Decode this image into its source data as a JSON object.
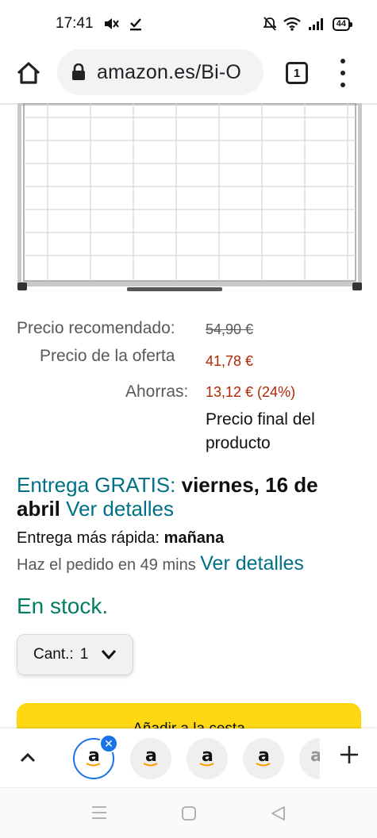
{
  "status_bar": {
    "time": "17:41",
    "battery": "44"
  },
  "browser": {
    "url": "amazon.es/Bi-O",
    "tab_count": "1"
  },
  "product": {
    "price_recommended_label": "Precio recomendado:",
    "price_recommended_value": "54,90 €",
    "deal_price_label": "Precio de la oferta",
    "deal_price_value": "41,78 €",
    "savings_label": "Ahorras:",
    "savings_value": "13,12 € (24%)",
    "final_price_note": "Precio final del producto"
  },
  "delivery": {
    "free_label": "Entrega GRATIS:",
    "date": "viernes, 16 de abril",
    "details_link": "Ver detalles",
    "fastest_label": "Entrega más rápida:",
    "fastest_value": "mañana",
    "order_within": "Haz el pedido en 49 mins",
    "order_details_link": "Ver detalles"
  },
  "stock": {
    "status": "En stock."
  },
  "quantity": {
    "label": "Cant.:",
    "value": "1"
  },
  "cart": {
    "add_label": "Añadir a la cesta"
  },
  "tab_strip": {
    "tab_letter": "a"
  },
  "colors": {
    "link": "#007185",
    "stock": "#067d62",
    "price_red": "#b12704",
    "cart_button": "#ffd814",
    "active_tab": "#1a73e8"
  },
  "icons": [
    "home-icon",
    "lock-icon",
    "tabs-icon",
    "menu-icon",
    "chevron-down-icon",
    "chevron-up-icon",
    "close-icon",
    "plus-icon",
    "amazon-icon"
  ]
}
